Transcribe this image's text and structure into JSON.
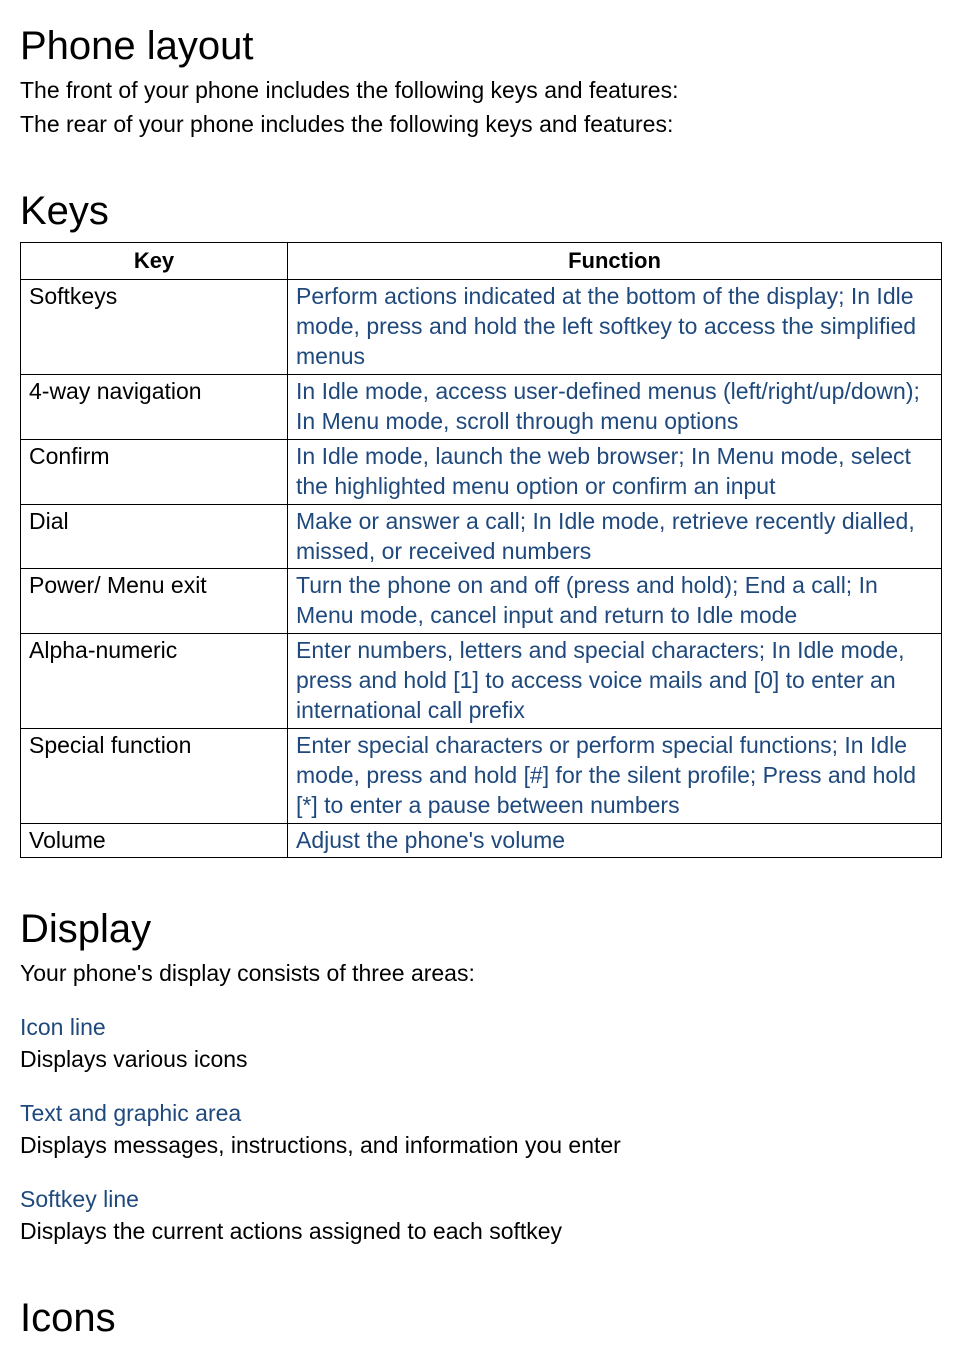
{
  "section1": {
    "heading": "Phone layout",
    "intro1": "The front of your phone includes the following keys and features:",
    "intro2": "The rear of your phone includes the following keys and features:"
  },
  "section2": {
    "heading": "Keys",
    "table": {
      "headers": {
        "col1": "Key",
        "col2": "Function"
      },
      "rows": [
        {
          "key": "Softkeys",
          "func": "Perform actions indicated at the bottom of the display; In Idle mode, press and hold the left softkey to access the simplified menus"
        },
        {
          "key": "4-way navigation",
          "func": "In Idle mode, access user-defined menus (left/right/up/down); In Menu mode, scroll through menu options"
        },
        {
          "key": "Confirm",
          "func": "In Idle mode, launch the web browser; In Menu mode, select the highlighted menu option or confirm an input"
        },
        {
          "key": "Dial",
          "func": "Make or answer a call; In Idle mode, retrieve recently dialled, missed, or received numbers"
        },
        {
          "key": "Power/ Menu exit",
          "func": "Turn the phone on and off (press and hold); End a call; In Menu mode, cancel input and return to Idle mode"
        },
        {
          "key": "Alpha-numeric",
          "func": "Enter numbers, letters and special characters; In Idle mode, press and hold [1] to access voice mails and [0] to enter an international call prefix"
        },
        {
          "key": "Special function",
          "func": "Enter special characters or perform special functions; In Idle mode, press and hold [#] for the silent profile; Press and hold [*] to enter a pause between numbers"
        },
        {
          "key": "Volume",
          "func": "Adjust the phone's volume"
        }
      ]
    }
  },
  "section3": {
    "heading": "Display",
    "intro": "Your phone's display consists of three areas:",
    "areas": [
      {
        "label": "Icon line",
        "desc": "Displays various icons"
      },
      {
        "label": "Text and graphic area",
        "desc": "Displays messages, instructions, and information you enter"
      },
      {
        "label": "Softkey line",
        "desc": "Displays the current actions assigned to each softkey"
      }
    ]
  },
  "section4": {
    "heading": "Icons"
  }
}
